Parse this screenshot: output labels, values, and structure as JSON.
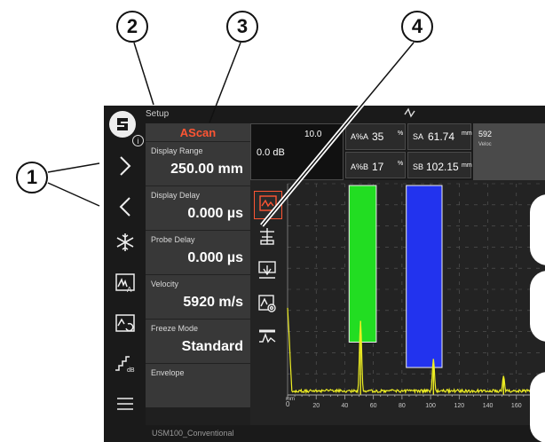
{
  "callouts": [
    "1",
    "2",
    "3",
    "4"
  ],
  "topbar": {
    "title": "Setup",
    "activity_icon": "activity-icon"
  },
  "leftbar": {
    "logo_icon": "logo-icon",
    "info_icon": "info-icon",
    "buttons": [
      "chevron-right-icon",
      "chevron-left-icon",
      "freeze-snowflake-icon",
      "ascan-gain-icon",
      "ascan-reset-icon",
      "db-steps-icon",
      "menu-icon"
    ]
  },
  "panel": {
    "header": "AScan",
    "params": [
      {
        "label": "Display Range",
        "value": "250.00 mm"
      },
      {
        "label": "Display Delay",
        "value": "0.000 µs"
      },
      {
        "label": "Probe Delay",
        "value": "0.000 µs"
      },
      {
        "label": "Velocity",
        "value": "5920 m/s"
      },
      {
        "label": "Freeze Mode",
        "value": "Standard"
      },
      {
        "label": "Envelope",
        "value": ""
      }
    ]
  },
  "readouts": {
    "gain_db": "10.0",
    "gain_main": "0.0 dB",
    "a_percent_label": "A%A",
    "a_percent_value": "35",
    "b_percent_label": "A%B",
    "b_percent_value": "17",
    "percent_unit": "%",
    "sa_label": "SA",
    "sa_value": "61.74",
    "sa_unit": "mm",
    "sb_label": "SB",
    "sb_value": "102.15",
    "sb_unit": "mm",
    "velocity_short_value": "592",
    "velocity_short_label": "Veloc"
  },
  "tools": [
    "ascan-view-icon",
    "gate-settings-icon",
    "gate-down-icon",
    "ascan-settings-icon",
    "envelope-icon"
  ],
  "statusbar": {
    "probe": "USM100_Conventional"
  },
  "chart_data": {
    "type": "line",
    "x_unit": "mm",
    "x_ticks": [
      20,
      40,
      60,
      80,
      100,
      120,
      140,
      160
    ],
    "xlim": [
      0,
      180
    ],
    "ylim": [
      0,
      100
    ],
    "gates": [
      {
        "name": "A",
        "color": "#22dd22",
        "x_start": 43,
        "x_end": 62,
        "threshold": 25
      },
      {
        "name": "B",
        "color": "#2233ee",
        "x_start": 83,
        "x_end": 108,
        "threshold": 13
      }
    ],
    "echoes": [
      {
        "x": 51,
        "amplitude": 35
      },
      {
        "x": 102,
        "amplitude": 17
      },
      {
        "x": 151,
        "amplitude": 9
      }
    ],
    "colors": {
      "signal": "#eeee22",
      "grid": "#5a5a5a"
    }
  }
}
